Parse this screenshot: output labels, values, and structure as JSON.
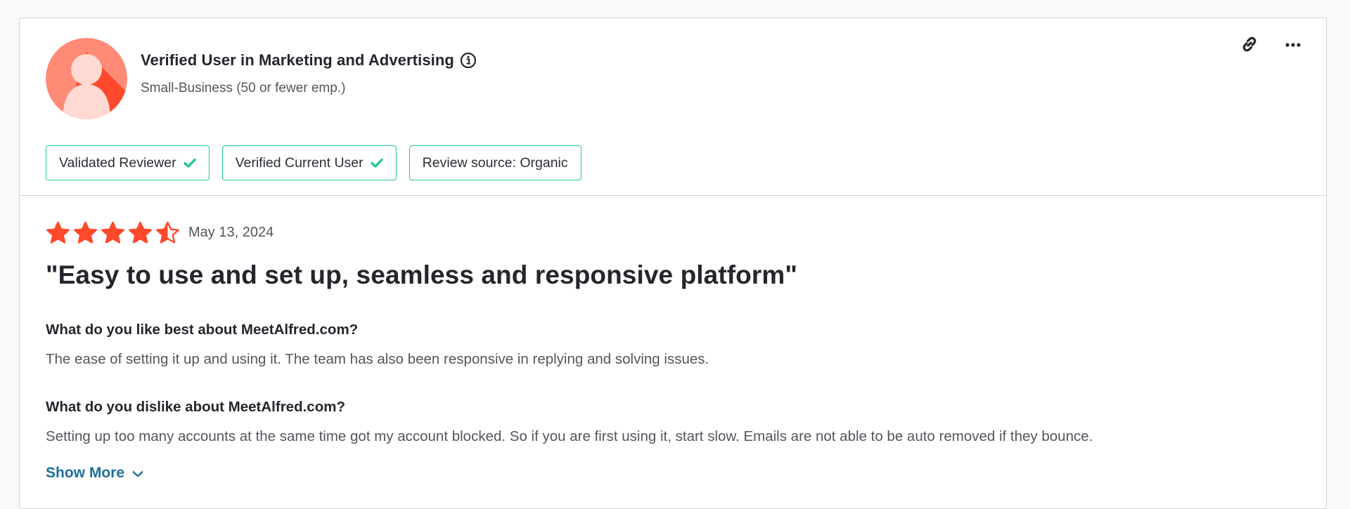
{
  "reviewer": {
    "name": "Verified User in Marketing and Advertising",
    "company_size": "Small-Business (50 or fewer emp.)"
  },
  "badges": [
    {
      "label": "Validated Reviewer",
      "checked": true
    },
    {
      "label": "Verified Current User",
      "checked": true
    },
    {
      "label": "Review source: Organic",
      "checked": false
    }
  ],
  "review": {
    "rating": 4.5,
    "rating_max": 5,
    "date": "May 13, 2024",
    "title": "\"Easy to use and set up, seamless and responsive platform\"",
    "questions": [
      {
        "question": "What do you like best about MeetAlfred.com?",
        "answer": "The ease of setting it up and using it. The team has also been responsive in replying and solving issues."
      },
      {
        "question": "What do you dislike about MeetAlfred.com?",
        "answer": "Setting up too many accounts at the same time got my account blocked. So if you are first using it, start slow. Emails are not able to be auto removed if they bounce."
      }
    ],
    "show_more_label": "Show More"
  },
  "icons": {
    "info": "info-icon",
    "link": "link-icon",
    "more": "more-options-icon",
    "check": "check-icon",
    "star": "star-icon",
    "chevron": "chevron-down-icon"
  },
  "colors": {
    "star": "#ff492c",
    "badge_border": "#20c997",
    "check": "#20c997",
    "link": "#1b6e9d",
    "avatar_bg": "#ff8a75",
    "avatar_shadow": "#ff492c",
    "avatar_figure": "#ffd9d2"
  }
}
